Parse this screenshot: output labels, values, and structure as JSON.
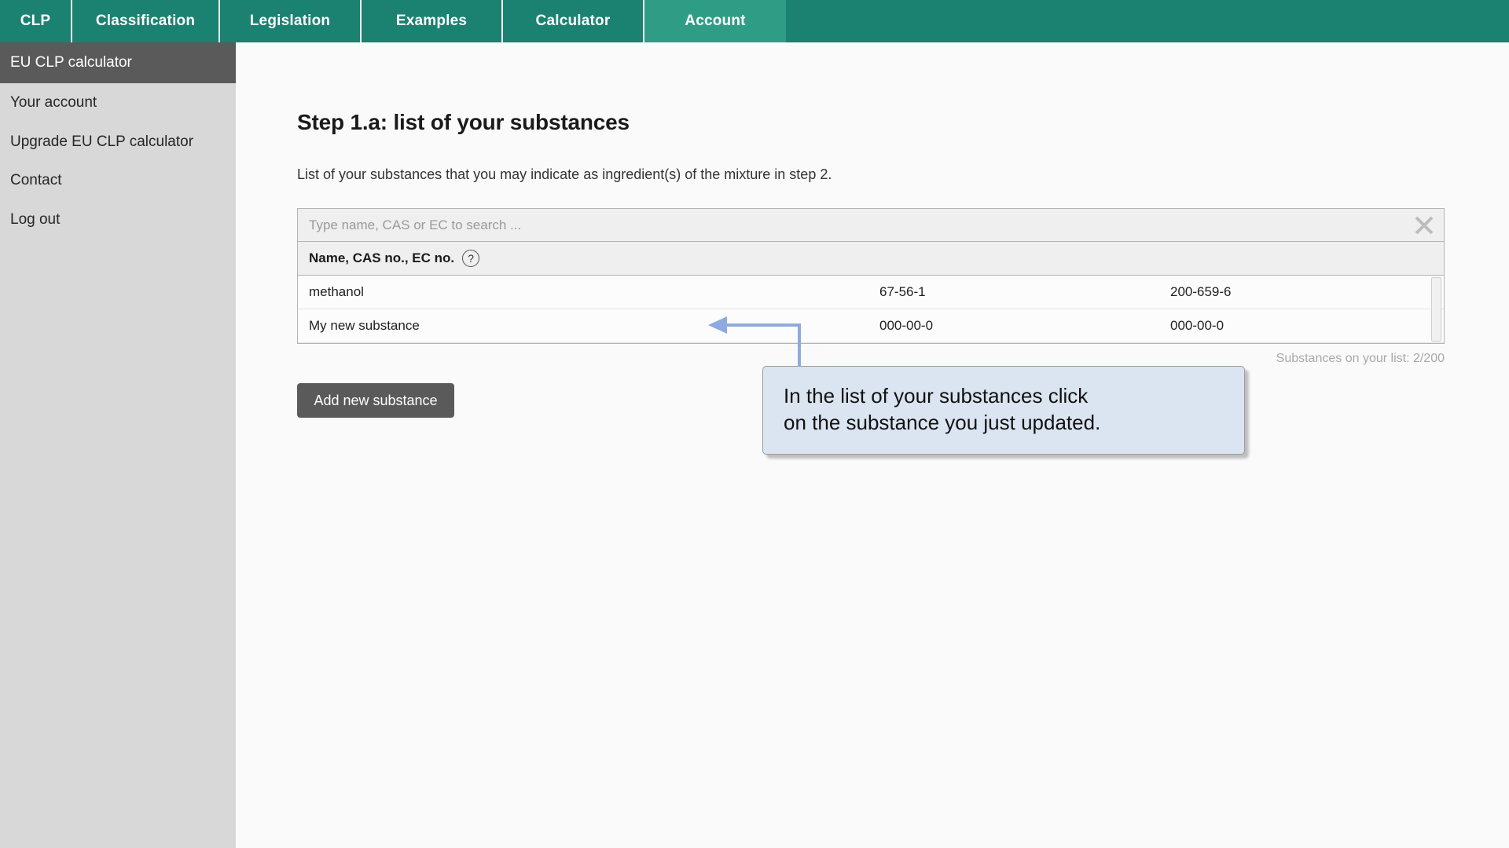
{
  "nav": {
    "tabs": [
      {
        "label": "CLP",
        "id": "nav-clp",
        "active": false
      },
      {
        "label": "Classification",
        "id": "nav-class",
        "active": false
      },
      {
        "label": "Legislation",
        "id": "nav-legis",
        "active": false
      },
      {
        "label": "Examples",
        "id": "nav-examples",
        "active": false
      },
      {
        "label": "Calculator",
        "id": "nav-calc",
        "active": false
      },
      {
        "label": "Account",
        "id": "nav-account",
        "active": true
      }
    ],
    "colors": {
      "bar": "#1b8170",
      "active_tab": "#2f9d86",
      "text": "#ffffff"
    }
  },
  "sidebar": {
    "items": [
      {
        "label": "EU CLP calculator",
        "current": true
      },
      {
        "label": "Your account",
        "current": false
      },
      {
        "label": "Upgrade EU CLP calculator",
        "current": false
      },
      {
        "label": "Contact",
        "current": false
      },
      {
        "label": "Log out",
        "current": false
      }
    ],
    "colors": {
      "background": "#d8d8d8",
      "current": "#5a5a5a"
    }
  },
  "main": {
    "title": "Step 1.a:  list of your substances",
    "description": "List of your substances that you may indicate as ingredient(s) of the mixture in step 2.",
    "search": {
      "value": "",
      "placeholder": "Type name, CAS or EC to search ...",
      "clear_icon": "close-x-icon"
    },
    "table": {
      "header": "Name, CAS no., EC no.",
      "help_icon": "?",
      "rows": [
        {
          "name": "methanol",
          "cas": "67-56-1",
          "ec": "200-659-6"
        },
        {
          "name": "My new substance",
          "cas": "000-00-0",
          "ec": "000-00-0"
        }
      ]
    },
    "count_text": "Substances on your list: 2/200",
    "add_button": "Add new substance"
  },
  "annotation": {
    "line1": "In the list of your substances click",
    "line2": "on the substance you just updated.",
    "arrow_color": "#8faadc",
    "box_color": "#dbe5f1"
  }
}
